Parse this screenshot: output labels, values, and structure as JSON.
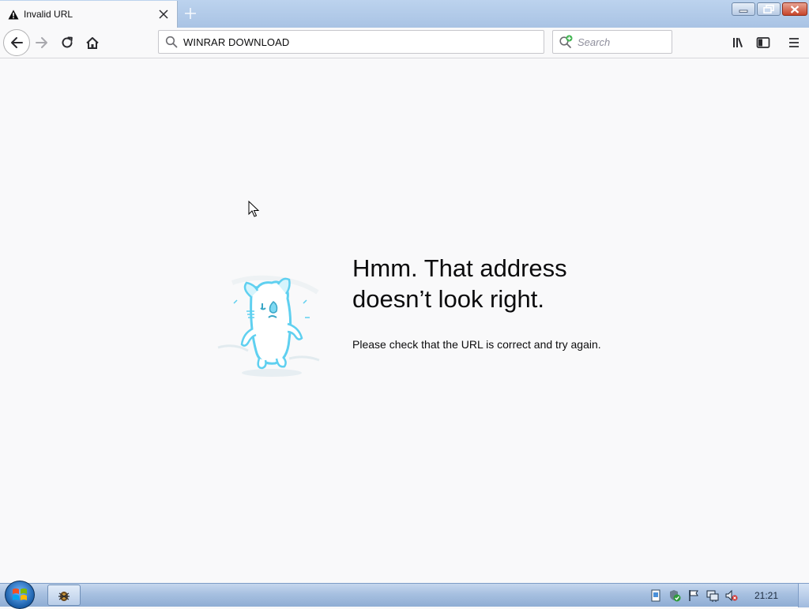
{
  "window": {
    "tab_title": "Invalid URL"
  },
  "toolbar": {
    "url_value": "WINRAR DOWNLOAD",
    "search_placeholder": "Search"
  },
  "error_page": {
    "title_line1": "Hmm. That address",
    "title_line2": "doesn’t look right.",
    "message": "Please check that the URL is correct and try again."
  },
  "taskbar": {
    "clock": "21:21"
  },
  "icons": {
    "tab": "warning-icon",
    "navigation": [
      "back-arrow-icon",
      "forward-arrow-icon",
      "reload-icon",
      "home-icon"
    ],
    "url": "magnifier-icon",
    "search": "search-engine-icon",
    "toolbar_right": [
      "library-icon",
      "sidebar-icon",
      "hamburger-menu-icon"
    ],
    "tray": [
      "document-icon",
      "security-shield-icon",
      "action-center-flag-icon",
      "network-icon",
      "volume-muted-icon"
    ]
  },
  "colors": {
    "page_background": "#f9f9fa",
    "text": "#0c0c0d",
    "illustration_accent": "#5fd0f0",
    "titlebar": "#bcd3ee",
    "close_button": "#c7452a"
  }
}
